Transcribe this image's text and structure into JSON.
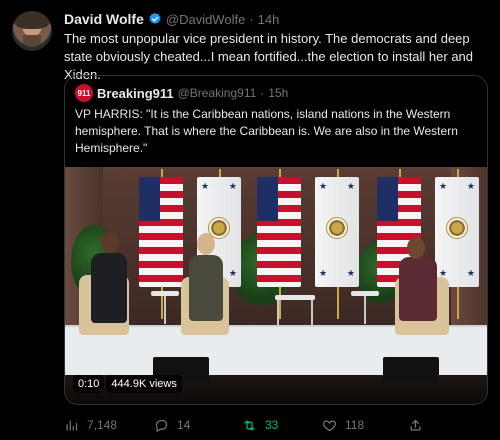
{
  "tweet": {
    "author_name": "David Wolfe",
    "handle": "@DavidWolfe",
    "separator": "·",
    "time": "14h",
    "text": "The most unpopular vice president in history. The democrats and deep state obviously cheated...I mean fortified...the election to install her and Xiden."
  },
  "quote": {
    "avatar_text": "911",
    "author_name": "Breaking911",
    "handle": "@Breaking911",
    "separator": "·",
    "time": "15h",
    "text": "VP HARRIS: \"It is the Caribbean nations, island nations in the Western hemisphere. That is where the Caribbean is. We are also in the Western Hemisphere.\"",
    "video": {
      "duration": "0:10",
      "views": "444.9K views"
    }
  },
  "actions": {
    "views": "7,148",
    "replies": "14",
    "retweets": "33",
    "likes": "118"
  },
  "colors": {
    "background": "#000000",
    "text": "#e7e9ea",
    "muted": "#71767b",
    "verified": "#1d9bf0",
    "retweet_active": "#00ba7c"
  },
  "icons": [
    "verified-badge-icon",
    "views-icon",
    "reply-icon",
    "retweet-icon",
    "like-icon",
    "share-icon"
  ]
}
